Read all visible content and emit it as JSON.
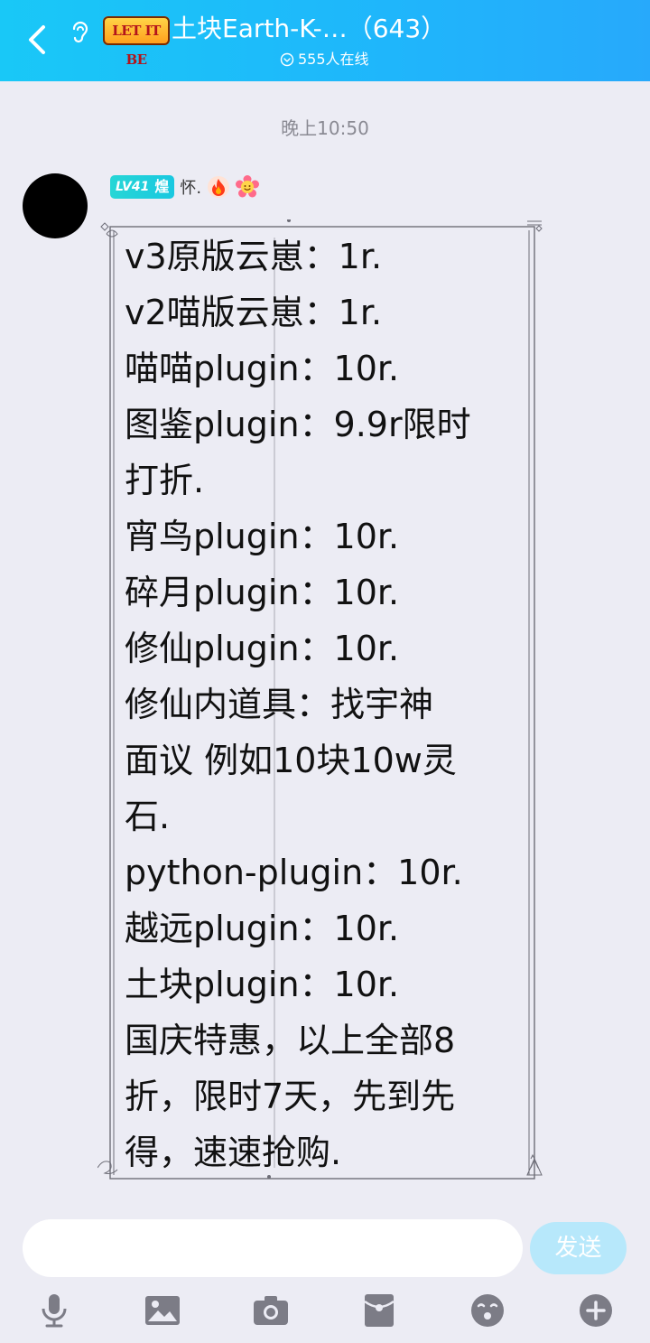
{
  "header": {
    "logo_text": "LET IT BE",
    "title": "土块Earth-K-…（643）",
    "online": "555人在线"
  },
  "chat": {
    "timestamp": "晚上10:50",
    "message": {
      "sender": {
        "level": "LV41",
        "badge": "煌",
        "name": "怀."
      },
      "lines": [
        "v3原版云崽：1r.",
        "v2喵版云崽：1r.",
        "喵喵plugin：10r.",
        "图鉴plugin：9.9r限时",
        "打折.",
        "宵鸟plugin：10r.",
        "碎月plugin：10r.",
        "修仙plugin：10r.",
        "修仙内道具：找宇神",
        "面议 例如10块10w灵",
        "石.",
        "python-plugin：10r.",
        "越远plugin：10r.",
        "土块plugin：10r.",
        "国庆特惠，以上全部8",
        "折，限时7天，先到先",
        "得，速速抢购."
      ]
    }
  },
  "input": {
    "send_label": "发送"
  },
  "toolbar": {
    "icons": [
      "microphone-icon",
      "image-icon",
      "camera-icon",
      "red-packet-icon",
      "emoji-icon",
      "plus-icon"
    ]
  },
  "colors": {
    "header_gradient_start": "#19c8f7",
    "header_gradient_end": "#27a9fb",
    "background": "#ececf4",
    "send_button": "#b7e8fb",
    "level_badge": "#26d6d6"
  }
}
